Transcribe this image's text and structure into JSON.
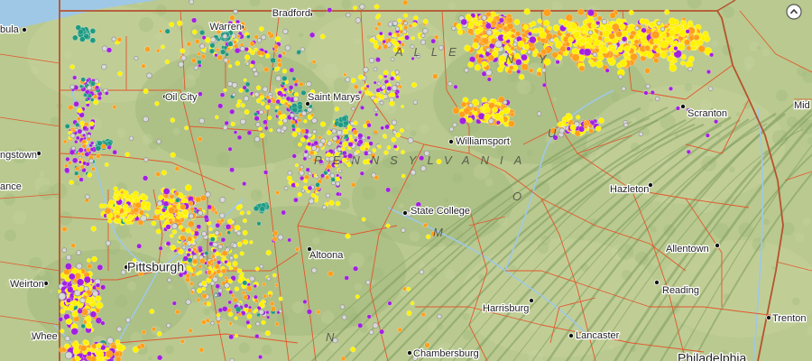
{
  "map": {
    "colors": {
      "land": "#b9c98f",
      "land_light": "#c9d5a0",
      "forest": "#9fb67a",
      "ridge": "#7d9a5e",
      "water": "#9fc8e6",
      "county_line": "#e2572c",
      "state_line": "#b5532f"
    },
    "well_colors": {
      "yellow": "#fff200",
      "orange": "#ff9f1a",
      "purple": "#a21fe0",
      "teal": "#1f9a82",
      "gray": "#d8d8d8"
    },
    "cities": [
      {
        "id": "bradford",
        "name": "Bradford"
      },
      {
        "id": "warren",
        "name": "Warren"
      },
      {
        "id": "oil-city",
        "name": "Oil City"
      },
      {
        "id": "saint-marys",
        "name": "Saint Marys"
      },
      {
        "id": "williamsport",
        "name": "Williamsport"
      },
      {
        "id": "scranton",
        "name": "Scranton"
      },
      {
        "id": "youngstown",
        "name": "ngstown"
      },
      {
        "id": "new-castle",
        "name": "ance"
      },
      {
        "id": "state-college",
        "name": "State College"
      },
      {
        "id": "hazleton",
        "name": "Hazleton"
      },
      {
        "id": "altoona",
        "name": "Altoona"
      },
      {
        "id": "allentown",
        "name": "Allentown"
      },
      {
        "id": "pittsburgh",
        "name": "Pittsburgh"
      },
      {
        "id": "weirton",
        "name": "Weirton"
      },
      {
        "id": "reading",
        "name": "Reading"
      },
      {
        "id": "harrisburg",
        "name": "Harrisburg"
      },
      {
        "id": "trenton",
        "name": "Trenton"
      },
      {
        "id": "lancaster",
        "name": "Lancaster"
      },
      {
        "id": "wheeling",
        "name": "Whee"
      },
      {
        "id": "chambersburg",
        "name": "Chambersburg"
      },
      {
        "id": "philadelphia",
        "name": "Philadelphia"
      },
      {
        "id": "ashtabula",
        "name": "bula"
      },
      {
        "id": "middletown",
        "name": "Mid"
      }
    ],
    "region_labels": [
      {
        "id": "pennsylvania",
        "text": "PENNSYLVANIA"
      },
      {
        "id": "allegheny",
        "text": "ALLE"
      },
      {
        "id": "ny-fragment",
        "text": "N Y"
      },
      {
        "id": "mountains-u",
        "text": "U"
      },
      {
        "id": "mountains-o",
        "text": "O"
      },
      {
        "id": "mountains-m",
        "text": "M"
      },
      {
        "id": "mountains-n",
        "text": "N"
      }
    ],
    "controls": {
      "expand_icon": "chevron-up-icon"
    }
  }
}
